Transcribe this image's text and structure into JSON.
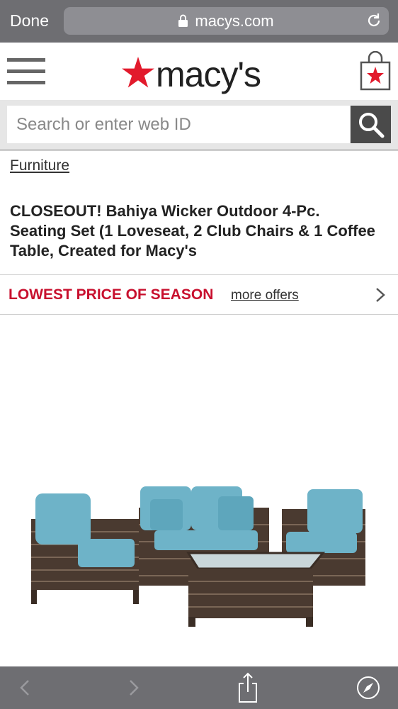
{
  "browser": {
    "done_label": "Done",
    "url": "macys.com"
  },
  "header": {
    "logo_text": "macy's"
  },
  "search": {
    "placeholder": "Search or enter web ID"
  },
  "breadcrumb": {
    "label": "Furniture"
  },
  "product": {
    "title": "CLOSEOUT! Bahiya Wicker Outdoor 4-Pc. Seating Set (1 Loveseat, 2 Club Chairs & 1 Coffee Table, Created for Macy's"
  },
  "promo": {
    "label": "LOWEST PRICE OF SEASON",
    "link": "more offers"
  },
  "colors": {
    "brand_red": "#e21a2c",
    "promo_red": "#c8102e",
    "cushion_blue": "#6eb3c8",
    "wicker_brown": "#4a3a30"
  },
  "icons": [
    "lock-icon",
    "reload-icon",
    "hamburger-menu-icon",
    "star-icon",
    "shopping-bag-icon",
    "search-icon",
    "chevron-right-icon",
    "back-arrow-icon",
    "forward-arrow-icon",
    "share-icon",
    "compass-icon"
  ]
}
